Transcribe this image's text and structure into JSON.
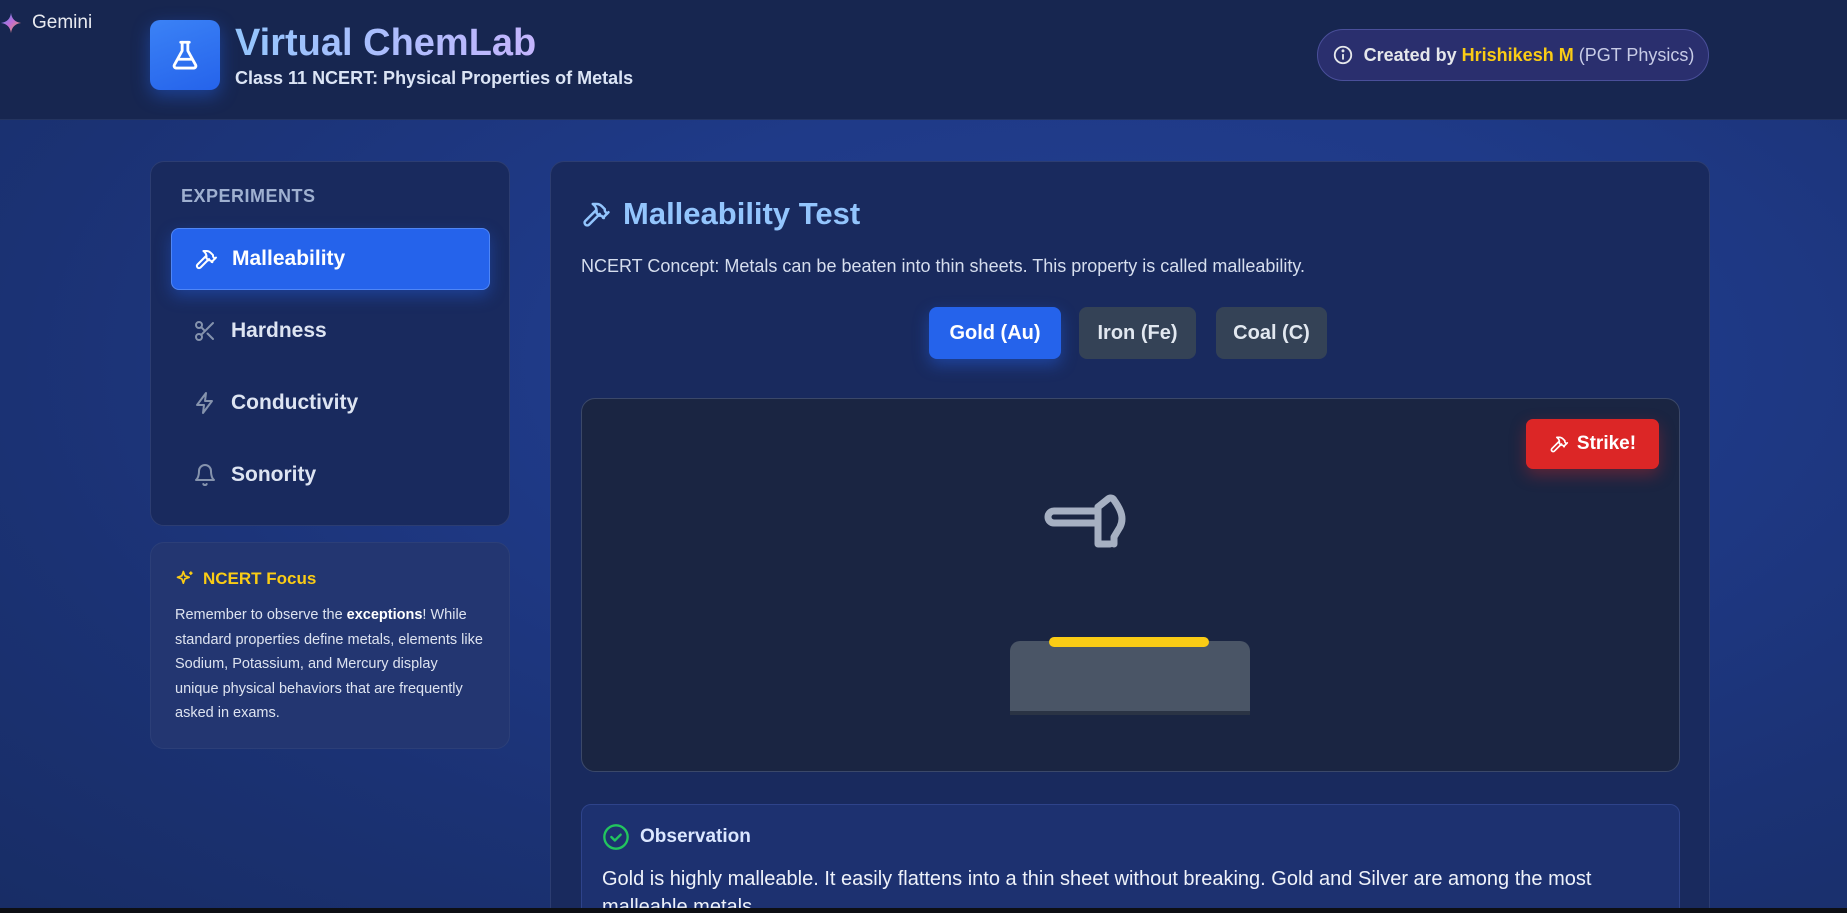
{
  "gemini": {
    "label": "Gemini"
  },
  "header": {
    "title": "Virtual ChemLab",
    "subtitle": "Class 11 NCERT: Physical Properties of Metals",
    "credit_prefix": "Created by",
    "credit_name": "Hrishikesh M",
    "credit_role": "(PGT Physics)"
  },
  "sidebar": {
    "heading": "EXPERIMENTS",
    "items": [
      {
        "label": "Malleability",
        "icon": "hammer-icon",
        "active": true
      },
      {
        "label": "Hardness",
        "icon": "scissors-icon",
        "active": false
      },
      {
        "label": "Conductivity",
        "icon": "lightning-icon",
        "active": false
      },
      {
        "label": "Sonority",
        "icon": "bell-icon",
        "active": false
      }
    ]
  },
  "focus": {
    "title": "NCERT Focus",
    "text_before": "Remember to observe the ",
    "text_bold": "exceptions",
    "text_after": "! While standard properties define metals, elements like Sodium, Potassium, and Mercury display unique physical behaviors that are frequently asked in exams."
  },
  "main": {
    "title": "Malleability Test",
    "concept": "NCERT Concept: Metals can be beaten into thin sheets. This property is called malleability.",
    "metals": [
      {
        "label": "Gold (Au)",
        "active": true
      },
      {
        "label": "Iron (Fe)",
        "active": false
      },
      {
        "label": "Coal (C)",
        "active": false
      }
    ],
    "strike_label": "Strike!",
    "observation_title": "Observation",
    "observation_text": "Gold is highly malleable. It easily flattens into a thin sheet without breaking. Gold and Silver are among the most malleable metals."
  },
  "colors": {
    "accent": "#2563eb",
    "gold": "#facc15",
    "strike": "#dc2626",
    "success": "#22c55e"
  }
}
